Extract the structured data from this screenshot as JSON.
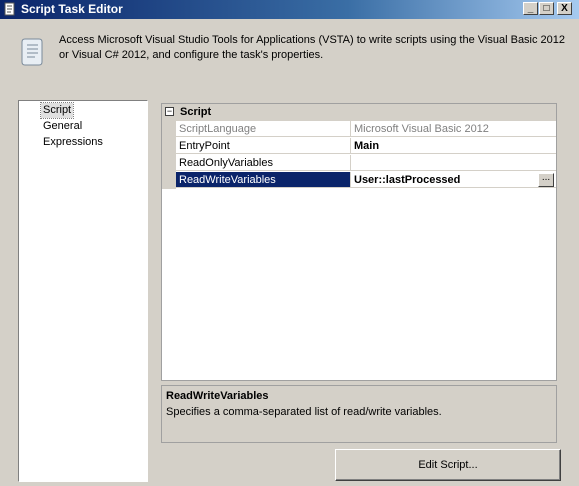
{
  "window": {
    "title": "Script Task Editor",
    "controls": {
      "minimize": "_",
      "maximize": "□",
      "close": "X"
    }
  },
  "header": {
    "icon": "script-scroll-icon",
    "line1": "Access Microsoft Visual Studio Tools for Applications (VSTA) to write scripts using the Visual Basic 2012",
    "line2": "or Visual C# 2012, and configure the task's properties."
  },
  "nav": {
    "items": [
      {
        "label": "Script",
        "selected": true
      },
      {
        "label": "General",
        "selected": false
      },
      {
        "label": "Expressions",
        "selected": false
      }
    ]
  },
  "grid": {
    "category": {
      "label": "Script",
      "expander": "⊟"
    },
    "rows": [
      {
        "name": "ScriptLanguage",
        "value": "Microsoft Visual Basic 2012",
        "dim": true
      },
      {
        "name": "EntryPoint",
        "value": "Main",
        "bold": true
      },
      {
        "name": "ReadOnlyVariables",
        "value": ""
      },
      {
        "name": "ReadWriteVariables",
        "value": "User::lastProcessed",
        "bold": true,
        "selected": true,
        "button": "..."
      }
    ]
  },
  "description": {
    "title": "ReadWriteVariables",
    "text": "Specifies a comma-separated list of read/write variables."
  },
  "buttons": {
    "edit_script": "Edit Script..."
  },
  "colors": {
    "title_gradient_start": "#0a246a",
    "selection": "#0a246a",
    "face": "#d4d0c8"
  }
}
